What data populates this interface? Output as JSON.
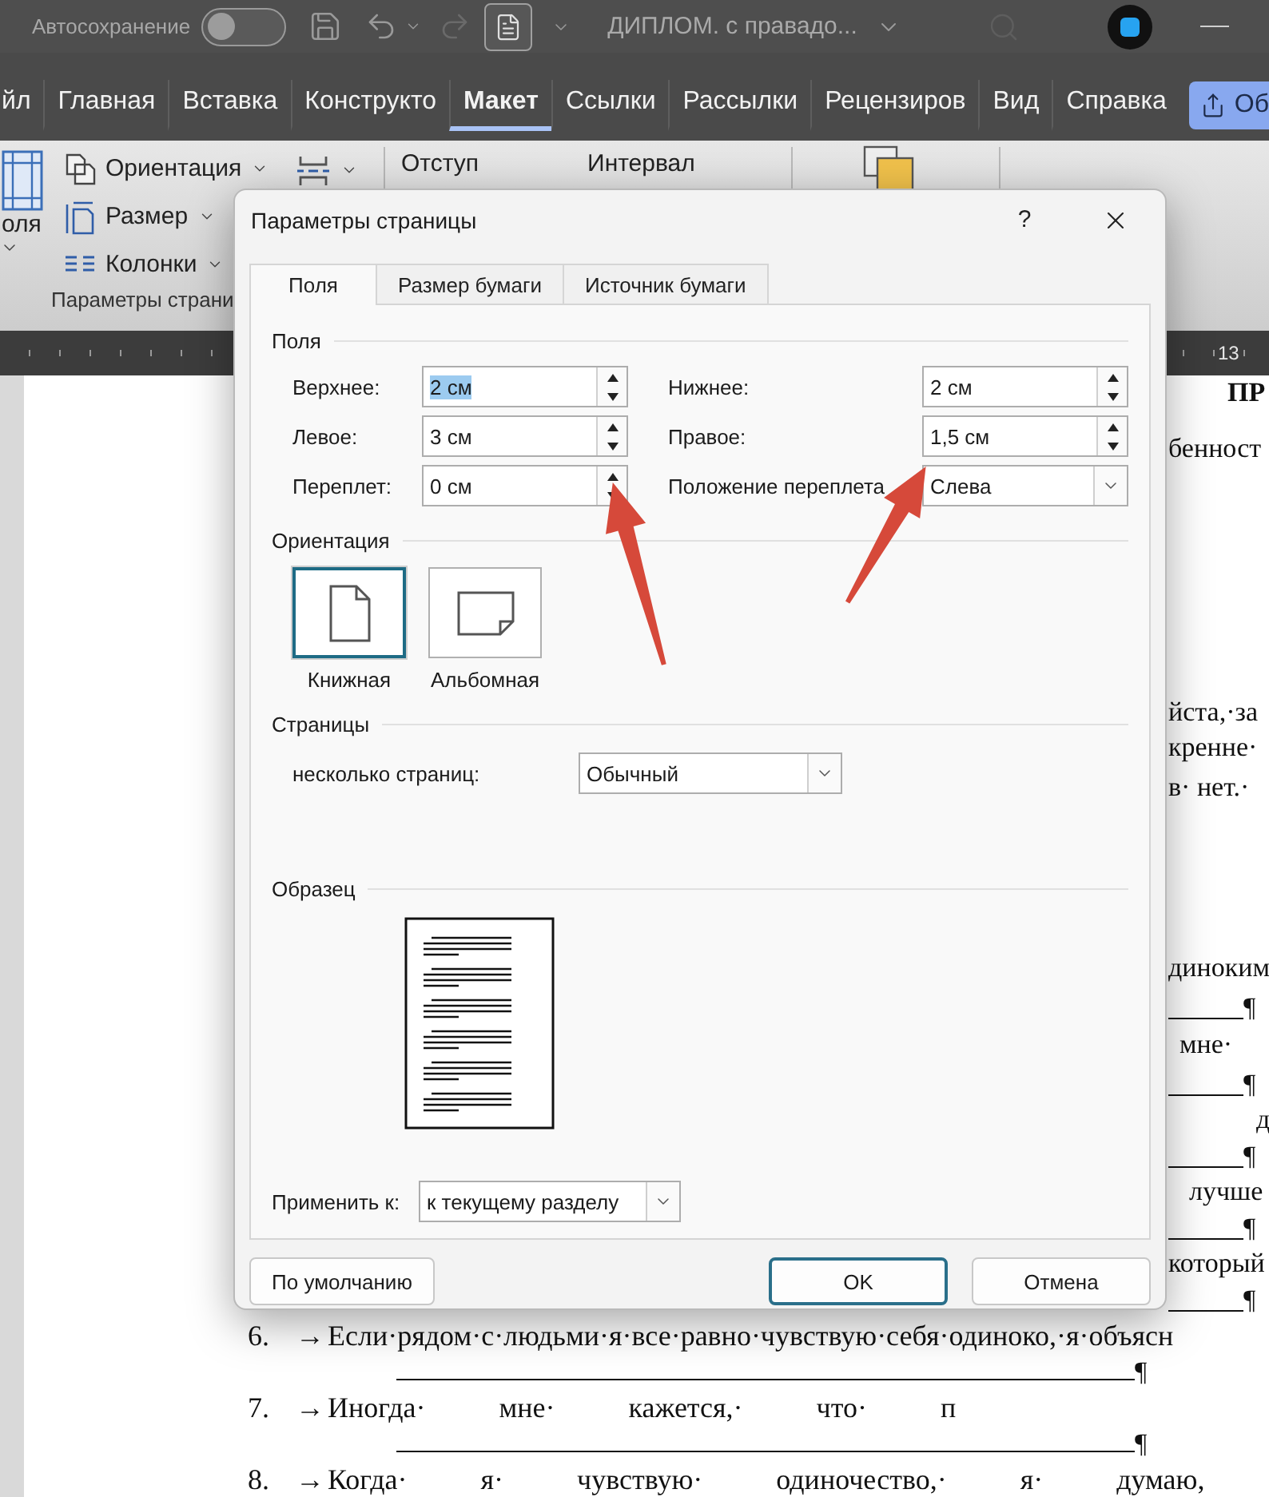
{
  "title_bar": {
    "autosave_label": "Автосохранение",
    "autosave_on": false,
    "document_title": "ДИПЛОМ. с правадо..."
  },
  "ribbon_tabs": [
    {
      "label": "йл",
      "selected": false
    },
    {
      "label": "Главная",
      "selected": false
    },
    {
      "label": "Вставка",
      "selected": false
    },
    {
      "label": "Конструкто",
      "selected": false
    },
    {
      "label": "Макет",
      "selected": true
    },
    {
      "label": "Ссылки",
      "selected": false
    },
    {
      "label": "Рассылки",
      "selected": false
    },
    {
      "label": "Рецензиров",
      "selected": false
    },
    {
      "label": "Вид",
      "selected": false
    },
    {
      "label": "Справка",
      "selected": false
    }
  ],
  "share_button": {
    "label": "Об"
  },
  "ribbon": {
    "margins_label": "оля",
    "setup_items": [
      {
        "label": "Ориентация",
        "kind": "orientation"
      },
      {
        "label": "Размер",
        "kind": "size"
      },
      {
        "label": "Колонки",
        "kind": "columns"
      }
    ],
    "paragraph_labels": [
      "Отступ",
      "Интервал"
    ],
    "group_label": "Параметры страни"
  },
  "ruler": {
    "number": "13"
  },
  "document": {
    "fragments": [
      {
        "kind": "text",
        "text": "ПР",
        "bold": true
      },
      {
        "kind": "text",
        "text": "бенност",
        "bold": false
      },
      {
        "kind": "text",
        "text": "йста,·за",
        "bold": false
      },
      {
        "kind": "text",
        "text": "кренне·",
        "bold": false
      },
      {
        "kind": "text",
        "text": "в· нет.·",
        "bold": false
      },
      {
        "kind": "text",
        "text": "диноким",
        "bold": false
      },
      {
        "kind": "rule",
        "mark": "¶"
      },
      {
        "kind": "text",
        "text": "мне·",
        "bold": false
      },
      {
        "kind": "rule",
        "mark": "¶"
      },
      {
        "kind": "text",
        "text": "д",
        "bold": false
      },
      {
        "kind": "rule",
        "mark": "¶"
      },
      {
        "kind": "text",
        "text": "лучше",
        "bold": false
      },
      {
        "kind": "rule",
        "mark": "¶"
      },
      {
        "kind": "text",
        "text": "который",
        "bold": false
      },
      {
        "kind": "rule",
        "mark": "¶"
      }
    ],
    "items": [
      {
        "kind": "line",
        "number": "6.",
        "arrow": "→",
        "words": [
          "Если·рядом·с·людьми·я·все·равно·чувствую·себя·одиноко,·я·объясн"
        ]
      },
      {
        "kind": "rule",
        "mark": "¶"
      },
      {
        "kind": "line",
        "number": "7.",
        "arrow": "→",
        "words": [
          "Иногда·",
          "мне·",
          "кажется,·",
          "что·",
          "п"
        ]
      },
      {
        "kind": "rule",
        "mark": "¶"
      },
      {
        "kind": "line",
        "number": "8.",
        "arrow": "→",
        "words": [
          "Когда·",
          "я·",
          "чувствую·",
          "одиночество,·",
          "я·",
          "думаю,"
        ]
      }
    ]
  },
  "dialog": {
    "title": "Параметры страницы",
    "help": "?",
    "tabs": [
      {
        "label": "Поля",
        "selected": true
      },
      {
        "label": "Размер бумаги",
        "selected": false
      },
      {
        "label": "Источник бумаги",
        "selected": false
      }
    ],
    "margins": {
      "heading": "Поля",
      "fields": [
        {
          "label": "Верхнее:",
          "value": "2 см",
          "kind": "spin",
          "highlighted": true
        },
        {
          "label": "Нижнее:",
          "value": "2 см",
          "kind": "spin",
          "highlighted": false
        },
        {
          "label": "Левое:",
          "value": "3 см",
          "kind": "spin",
          "highlighted": false
        },
        {
          "label": "Правое:",
          "value": "1,5 см",
          "kind": "spin",
          "highlighted": false
        },
        {
          "label": "Переплет:",
          "value": "0 см",
          "kind": "spin",
          "highlighted": false
        },
        {
          "label": "Положение переплета",
          "value": "Слева",
          "kind": "select",
          "highlighted": false
        }
      ]
    },
    "orientation": {
      "heading": "Ориентация",
      "options": [
        {
          "label": "Книжная",
          "kind": "portrait",
          "selected": true
        },
        {
          "label": "Альбомная",
          "kind": "landscape",
          "selected": false
        }
      ]
    },
    "pages": {
      "heading": "Страницы",
      "label": "несколько страниц:",
      "value": "Обычный"
    },
    "preview": {
      "heading": "Образец"
    },
    "apply": {
      "label": "Применить к:",
      "value": "к текущему разделу"
    },
    "buttons": [
      {
        "label": "По умолчанию",
        "default": false
      },
      {
        "label": "OK",
        "default": true
      },
      {
        "label": "Отмена",
        "default": false
      }
    ]
  }
}
